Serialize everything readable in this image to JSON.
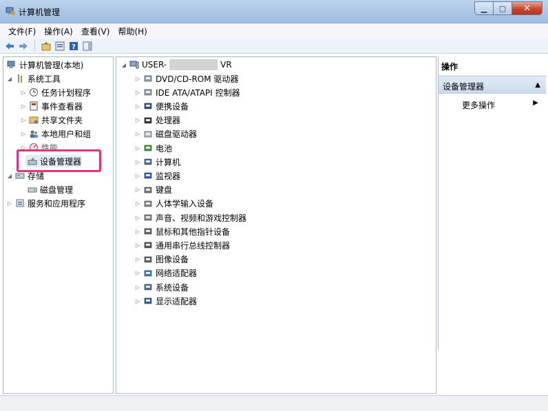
{
  "window": {
    "title": "计算机管理"
  },
  "menu": [
    "文件(F)",
    "操作(A)",
    "查看(V)",
    "帮助(H)"
  ],
  "toolbar": {
    "icons": [
      "back-icon",
      "forward-icon",
      "up-icon",
      "properties-icon",
      "help-icon",
      "show-hide-icon"
    ]
  },
  "tree": {
    "root": "计算机管理(本地)",
    "system_tools": "系统工具",
    "task_scheduler": "任务计划程序",
    "event_viewer": "事件查看器",
    "shared_folders": "共享文件夹",
    "local_users": "本地用户和组",
    "performance": "性能",
    "device_manager": "设备管理器",
    "storage": "存储",
    "disk_management": "磁盘管理",
    "services_apps": "服务和应用程序"
  },
  "devices": {
    "computer_prefix": "USER-",
    "computer_suffix": "VR",
    "items": [
      "DVD/CD-ROM 驱动器",
      "IDE ATA/ATAPI 控制器",
      "便携设备",
      "处理器",
      "磁盘驱动器",
      "电池",
      "计算机",
      "监视器",
      "键盘",
      "人体学输入设备",
      "声音、视频和游戏控制器",
      "鼠标和其他指针设备",
      "通用串行总线控制器",
      "图像设备",
      "网络适配器",
      "系统设备",
      "显示适配器"
    ]
  },
  "actions": {
    "header": "操作",
    "section": "设备管理器",
    "more": "更多操作"
  },
  "colors": {
    "highlight": "#e6317a",
    "titlebar": "#a9c6e6"
  }
}
